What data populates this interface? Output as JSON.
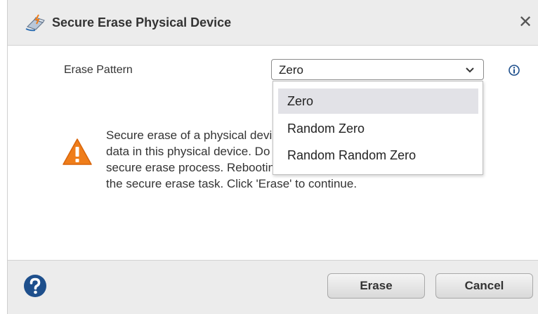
{
  "dialog": {
    "title": "Secure Erase Physical Device",
    "close_glyph": "✕",
    "icons": {
      "title": "eraser-icon",
      "close": "close-icon",
      "info": "info-icon",
      "warning": "warning-icon",
      "help": "help-icon"
    }
  },
  "form": {
    "erase_pattern_label": "Erase Pattern",
    "erase_pattern_value": "Zero",
    "options": [
      "Zero",
      "Random Zero",
      "Random Random Zero"
    ],
    "selected_option": "Zero"
  },
  "message": {
    "line1": "Secure erase of a physical device will erase all",
    "line2": "data in this physical device. Do not reboot during",
    "line3": "secure erase process. Rebooting the server would stop",
    "line4": "the secure erase task. Click 'Erase' to continue."
  },
  "footer": {
    "erase_label": "Erase",
    "cancel_label": "Cancel"
  },
  "colors": {
    "warning": "#ef7d1a",
    "help": "#1e4f8c",
    "info": "#1e4f8c"
  }
}
